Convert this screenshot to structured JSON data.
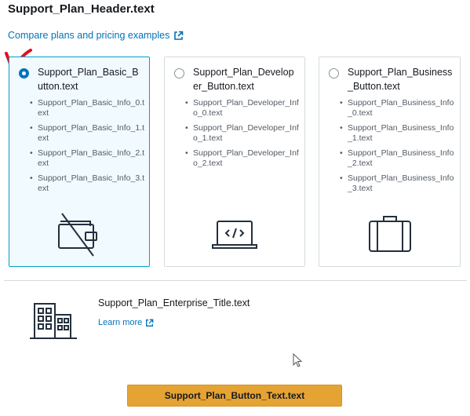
{
  "header": {
    "title": "Support_Plan_Header.text"
  },
  "compare_link": {
    "label": "Compare plans and pricing examples",
    "icon": "external-link-icon"
  },
  "plans": [
    {
      "title": "Support_Plan_Basic_Button.text",
      "selected": true,
      "info": [
        "Support_Plan_Basic_Info_0.text",
        "Support_Plan_Basic_Info_1.text",
        "Support_Plan_Basic_Info_2.text",
        "Support_Plan_Basic_Info_3.text"
      ],
      "icon": "no-cost-wallet-icon"
    },
    {
      "title": "Support_Plan_Developer_Button.text",
      "selected": false,
      "info": [
        "Support_Plan_Developer_Info_0.text",
        "Support_Plan_Developer_Info_1.text",
        "Support_Plan_Developer_Info_2.text"
      ],
      "icon": "laptop-code-icon"
    },
    {
      "title": "Support_Plan_Business_Button.text",
      "selected": false,
      "info": [
        "Support_Plan_Business_Info_0.text",
        "Support_Plan_Business_Info_1.text",
        "Support_Plan_Business_Info_2.text",
        "Support_Plan_Business_Info_3.text"
      ],
      "icon": "briefcase-icon"
    }
  ],
  "enterprise": {
    "title": "Support_Plan_Enterprise_Title.text",
    "learn_more": "Learn more",
    "icon": "office-building-icon"
  },
  "primary_button": {
    "label": "Support_Plan_Button_Text.text"
  },
  "colors": {
    "link": "#0073bb",
    "selected_border": "#00a1c9",
    "selected_bg": "#f1faff",
    "button": "#e5a333",
    "annotation": "#e0101e"
  }
}
